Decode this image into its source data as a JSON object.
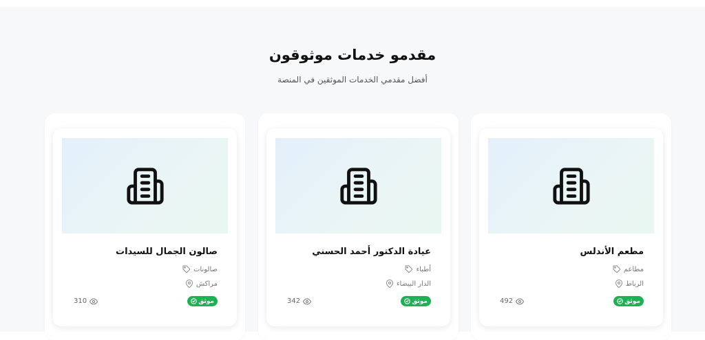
{
  "section": {
    "title": "مقدمو خدمات موثوقون",
    "subtitle": "أفضل مقدمي الخدمات الموثقين في المنصة"
  },
  "providers": [
    {
      "name": "مطعم الأندلس",
      "category": "مطاعم",
      "city": "الرباط",
      "badge": "موثق",
      "views": "492",
      "image_icon": "building-icon",
      "category_icon": "tag-icon",
      "city_icon": "map-pin-icon",
      "badge_icon": "check-circle-icon",
      "views_icon": "eye-icon"
    },
    {
      "name": "عيادة الدكتور أحمد الحسني",
      "category": "أطباء",
      "city": "الدار البيضاء",
      "badge": "موثق",
      "views": "342",
      "image_icon": "building-icon",
      "category_icon": "tag-icon",
      "city_icon": "map-pin-icon",
      "badge_icon": "check-circle-icon",
      "views_icon": "eye-icon"
    },
    {
      "name": "صالون الجمال للسيدات",
      "category": "صالونات",
      "city": "مراكش",
      "badge": "موثق",
      "views": "310",
      "image_icon": "building-icon",
      "category_icon": "tag-icon",
      "city_icon": "map-pin-icon",
      "badge_icon": "check-circle-icon",
      "views_icon": "eye-icon"
    }
  ],
  "colors": {
    "badge_bg": "#1eb154",
    "section_bg": "#f7f8fa",
    "thumb_gradient_start": "#e3f0fb",
    "thumb_gradient_end": "#e9f7f1"
  }
}
